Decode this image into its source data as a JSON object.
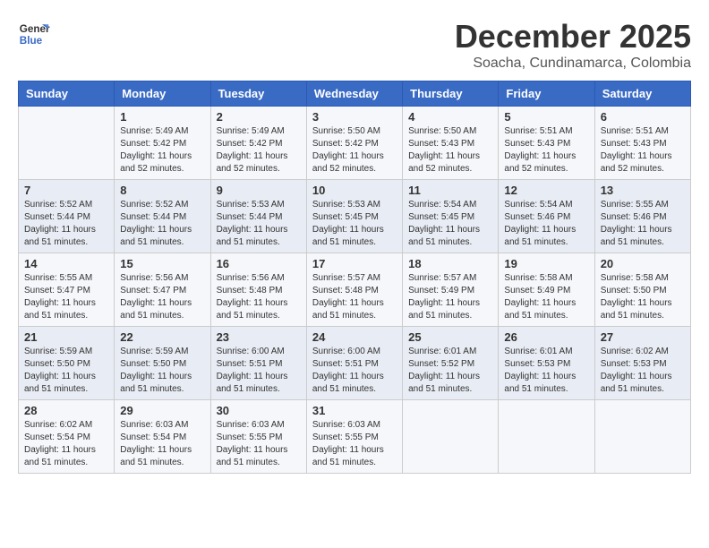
{
  "header": {
    "logo_line1": "General",
    "logo_line2": "Blue",
    "month": "December 2025",
    "location": "Soacha, Cundinamarca, Colombia"
  },
  "days_of_week": [
    "Sunday",
    "Monday",
    "Tuesday",
    "Wednesday",
    "Thursday",
    "Friday",
    "Saturday"
  ],
  "weeks": [
    [
      {
        "day": "",
        "info": ""
      },
      {
        "day": "1",
        "info": "Sunrise: 5:49 AM\nSunset: 5:42 PM\nDaylight: 11 hours\nand 52 minutes."
      },
      {
        "day": "2",
        "info": "Sunrise: 5:49 AM\nSunset: 5:42 PM\nDaylight: 11 hours\nand 52 minutes."
      },
      {
        "day": "3",
        "info": "Sunrise: 5:50 AM\nSunset: 5:42 PM\nDaylight: 11 hours\nand 52 minutes."
      },
      {
        "day": "4",
        "info": "Sunrise: 5:50 AM\nSunset: 5:43 PM\nDaylight: 11 hours\nand 52 minutes."
      },
      {
        "day": "5",
        "info": "Sunrise: 5:51 AM\nSunset: 5:43 PM\nDaylight: 11 hours\nand 52 minutes."
      },
      {
        "day": "6",
        "info": "Sunrise: 5:51 AM\nSunset: 5:43 PM\nDaylight: 11 hours\nand 52 minutes."
      }
    ],
    [
      {
        "day": "7",
        "info": "Sunrise: 5:52 AM\nSunset: 5:44 PM\nDaylight: 11 hours\nand 51 minutes."
      },
      {
        "day": "8",
        "info": "Sunrise: 5:52 AM\nSunset: 5:44 PM\nDaylight: 11 hours\nand 51 minutes."
      },
      {
        "day": "9",
        "info": "Sunrise: 5:53 AM\nSunset: 5:44 PM\nDaylight: 11 hours\nand 51 minutes."
      },
      {
        "day": "10",
        "info": "Sunrise: 5:53 AM\nSunset: 5:45 PM\nDaylight: 11 hours\nand 51 minutes."
      },
      {
        "day": "11",
        "info": "Sunrise: 5:54 AM\nSunset: 5:45 PM\nDaylight: 11 hours\nand 51 minutes."
      },
      {
        "day": "12",
        "info": "Sunrise: 5:54 AM\nSunset: 5:46 PM\nDaylight: 11 hours\nand 51 minutes."
      },
      {
        "day": "13",
        "info": "Sunrise: 5:55 AM\nSunset: 5:46 PM\nDaylight: 11 hours\nand 51 minutes."
      }
    ],
    [
      {
        "day": "14",
        "info": "Sunrise: 5:55 AM\nSunset: 5:47 PM\nDaylight: 11 hours\nand 51 minutes."
      },
      {
        "day": "15",
        "info": "Sunrise: 5:56 AM\nSunset: 5:47 PM\nDaylight: 11 hours\nand 51 minutes."
      },
      {
        "day": "16",
        "info": "Sunrise: 5:56 AM\nSunset: 5:48 PM\nDaylight: 11 hours\nand 51 minutes."
      },
      {
        "day": "17",
        "info": "Sunrise: 5:57 AM\nSunset: 5:48 PM\nDaylight: 11 hours\nand 51 minutes."
      },
      {
        "day": "18",
        "info": "Sunrise: 5:57 AM\nSunset: 5:49 PM\nDaylight: 11 hours\nand 51 minutes."
      },
      {
        "day": "19",
        "info": "Sunrise: 5:58 AM\nSunset: 5:49 PM\nDaylight: 11 hours\nand 51 minutes."
      },
      {
        "day": "20",
        "info": "Sunrise: 5:58 AM\nSunset: 5:50 PM\nDaylight: 11 hours\nand 51 minutes."
      }
    ],
    [
      {
        "day": "21",
        "info": "Sunrise: 5:59 AM\nSunset: 5:50 PM\nDaylight: 11 hours\nand 51 minutes."
      },
      {
        "day": "22",
        "info": "Sunrise: 5:59 AM\nSunset: 5:50 PM\nDaylight: 11 hours\nand 51 minutes."
      },
      {
        "day": "23",
        "info": "Sunrise: 6:00 AM\nSunset: 5:51 PM\nDaylight: 11 hours\nand 51 minutes."
      },
      {
        "day": "24",
        "info": "Sunrise: 6:00 AM\nSunset: 5:51 PM\nDaylight: 11 hours\nand 51 minutes."
      },
      {
        "day": "25",
        "info": "Sunrise: 6:01 AM\nSunset: 5:52 PM\nDaylight: 11 hours\nand 51 minutes."
      },
      {
        "day": "26",
        "info": "Sunrise: 6:01 AM\nSunset: 5:53 PM\nDaylight: 11 hours\nand 51 minutes."
      },
      {
        "day": "27",
        "info": "Sunrise: 6:02 AM\nSunset: 5:53 PM\nDaylight: 11 hours\nand 51 minutes."
      }
    ],
    [
      {
        "day": "28",
        "info": "Sunrise: 6:02 AM\nSunset: 5:54 PM\nDaylight: 11 hours\nand 51 minutes."
      },
      {
        "day": "29",
        "info": "Sunrise: 6:03 AM\nSunset: 5:54 PM\nDaylight: 11 hours\nand 51 minutes."
      },
      {
        "day": "30",
        "info": "Sunrise: 6:03 AM\nSunset: 5:55 PM\nDaylight: 11 hours\nand 51 minutes."
      },
      {
        "day": "31",
        "info": "Sunrise: 6:03 AM\nSunset: 5:55 PM\nDaylight: 11 hours\nand 51 minutes."
      },
      {
        "day": "",
        "info": ""
      },
      {
        "day": "",
        "info": ""
      },
      {
        "day": "",
        "info": ""
      }
    ]
  ]
}
